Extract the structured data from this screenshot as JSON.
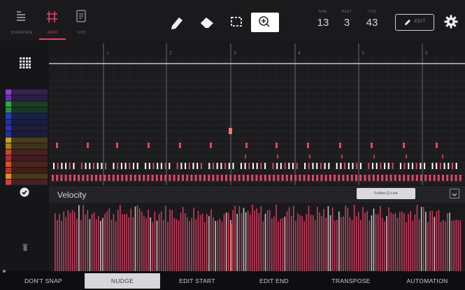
{
  "modes": [
    {
      "name": "mode-overview",
      "label": "OVERVIEW",
      "active": false
    },
    {
      "name": "mode-grid",
      "label": "GRID",
      "active": true
    },
    {
      "name": "mode-list",
      "label": "LIST",
      "active": false
    }
  ],
  "position": {
    "bar": {
      "label": "BAR",
      "value": "13"
    },
    "beat": {
      "label": "BEAT",
      "value": "3"
    },
    "tick": {
      "label": "TICK",
      "value": "43"
    }
  },
  "edit_label": "EDIT",
  "ruler_labels": [
    "1",
    "2",
    "3",
    "4",
    "5",
    "6"
  ],
  "velocity": {
    "label": "Velocity",
    "pill": "Follow Q-Link"
  },
  "colors": {
    "accent": "#e0456a",
    "note": "#e0456a",
    "selected_note": "#f07a6a",
    "white_note": "#ffffff"
  },
  "tracks": [
    {
      "color": "#8a3fd0"
    },
    {
      "color": "#6a2fb0"
    },
    {
      "color": "#2fa84a"
    },
    {
      "color": "#2b8f3f"
    },
    {
      "color": "#1f3fbf"
    },
    {
      "color": "#1a33a0"
    },
    {
      "color": "#3a2fa8"
    },
    {
      "color": "#2030a0"
    },
    {
      "color": "#c8a028"
    },
    {
      "color": "#a88520"
    },
    {
      "color": "#c84a20"
    },
    {
      "color": "#b02a40"
    },
    {
      "color": "#e05020"
    },
    {
      "color": "#c03020"
    },
    {
      "color": "#e09020"
    },
    {
      "color": "#d04040"
    }
  ],
  "functions": [
    "DON'T SNAP",
    "NUDGE",
    "EDIT START",
    "EDIT END",
    "TRANSPOSE",
    "AUTOMATION"
  ],
  "active_function": 1
}
